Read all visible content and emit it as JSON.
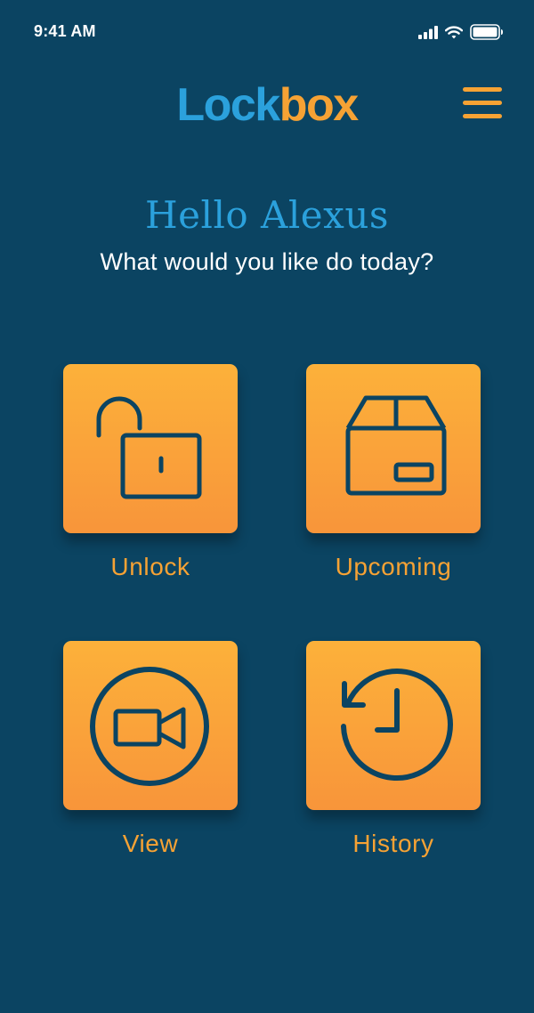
{
  "status_bar": {
    "time": "9:41 AM"
  },
  "header": {
    "logo": {
      "part_1": "Lock",
      "part_2": "box"
    },
    "menu_icon": "hamburger-menu-icon"
  },
  "greeting": {
    "title": "Hello Alexus",
    "subtitle": "What would you like do today?"
  },
  "actions": [
    {
      "label": "Unlock",
      "icon": "open-padlock-icon"
    },
    {
      "label": "Upcoming",
      "icon": "package-box-icon"
    },
    {
      "label": "View",
      "icon": "video-camera-icon"
    },
    {
      "label": "History",
      "icon": "history-clock-icon"
    }
  ],
  "colors": {
    "background": "#0b4462",
    "brand_blue": "#2ba1dc",
    "brand_orange": "#f6a234",
    "tile_gradient_top": "#fcb13a",
    "tile_gradient_bottom": "#f8953a",
    "icon_stroke": "#0b4462"
  }
}
